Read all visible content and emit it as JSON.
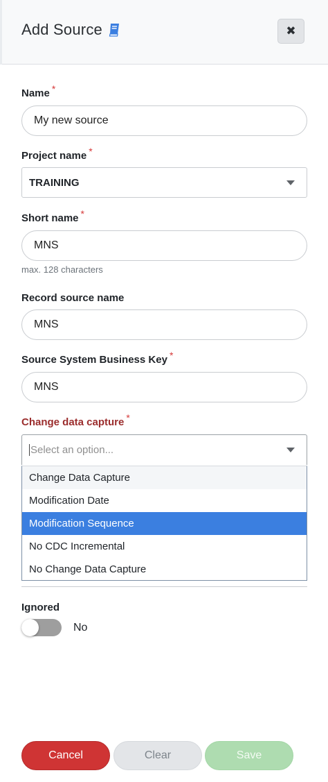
{
  "header": {
    "title": "Add Source",
    "close_label": "✖"
  },
  "fields": {
    "name": {
      "label": "Name",
      "required": "*",
      "value": "My new source"
    },
    "project": {
      "label": "Project name",
      "required": "*",
      "value": "TRAINING"
    },
    "short_name": {
      "label": "Short name",
      "required": "*",
      "value": "MNS",
      "help": "max. 128 characters"
    },
    "record_source": {
      "label": "Record source name",
      "value": "MNS"
    },
    "business_key": {
      "label": "Source System Business Key",
      "required": "*",
      "value": "MNS"
    },
    "cdc": {
      "label": "Change data capture",
      "required": "*",
      "placeholder": "Select an option...",
      "options": [
        "Change Data Capture",
        "Modification Date",
        "Modification Sequence",
        "No CDC Incremental",
        "No Change Data Capture"
      ],
      "highlighted": "Modification Sequence"
    },
    "ignored": {
      "label": "Ignored",
      "state_text": "No",
      "on": false
    }
  },
  "footer": {
    "cancel_label": "Cancel",
    "clear_label": "Clear",
    "save_label": "Save"
  },
  "colors": {
    "danger": "#cf3434",
    "highlight": "#3b7fe0",
    "save_disabled": "#aedcb0",
    "error_label": "#9b2d2d"
  },
  "icons": {
    "title_icon": "book-icon",
    "close": "close-icon",
    "select_caret": "chevron-down-icon"
  }
}
